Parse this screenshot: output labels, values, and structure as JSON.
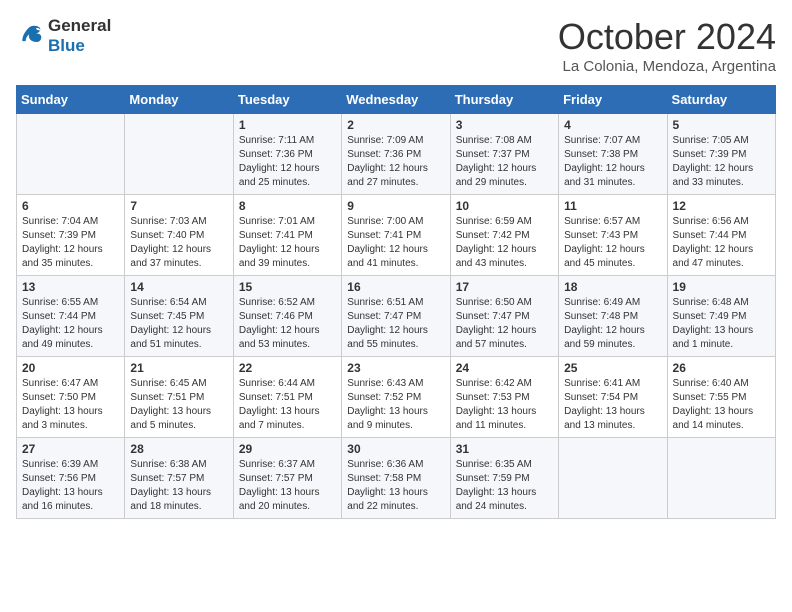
{
  "header": {
    "logo_line1": "General",
    "logo_line2": "Blue",
    "month": "October 2024",
    "location": "La Colonia, Mendoza, Argentina"
  },
  "weekdays": [
    "Sunday",
    "Monday",
    "Tuesday",
    "Wednesday",
    "Thursday",
    "Friday",
    "Saturday"
  ],
  "weeks": [
    [
      {
        "day": "",
        "info": ""
      },
      {
        "day": "",
        "info": ""
      },
      {
        "day": "1",
        "info": "Sunrise: 7:11 AM\nSunset: 7:36 PM\nDaylight: 12 hours\nand 25 minutes."
      },
      {
        "day": "2",
        "info": "Sunrise: 7:09 AM\nSunset: 7:36 PM\nDaylight: 12 hours\nand 27 minutes."
      },
      {
        "day": "3",
        "info": "Sunrise: 7:08 AM\nSunset: 7:37 PM\nDaylight: 12 hours\nand 29 minutes."
      },
      {
        "day": "4",
        "info": "Sunrise: 7:07 AM\nSunset: 7:38 PM\nDaylight: 12 hours\nand 31 minutes."
      },
      {
        "day": "5",
        "info": "Sunrise: 7:05 AM\nSunset: 7:39 PM\nDaylight: 12 hours\nand 33 minutes."
      }
    ],
    [
      {
        "day": "6",
        "info": "Sunrise: 7:04 AM\nSunset: 7:39 PM\nDaylight: 12 hours\nand 35 minutes."
      },
      {
        "day": "7",
        "info": "Sunrise: 7:03 AM\nSunset: 7:40 PM\nDaylight: 12 hours\nand 37 minutes."
      },
      {
        "day": "8",
        "info": "Sunrise: 7:01 AM\nSunset: 7:41 PM\nDaylight: 12 hours\nand 39 minutes."
      },
      {
        "day": "9",
        "info": "Sunrise: 7:00 AM\nSunset: 7:41 PM\nDaylight: 12 hours\nand 41 minutes."
      },
      {
        "day": "10",
        "info": "Sunrise: 6:59 AM\nSunset: 7:42 PM\nDaylight: 12 hours\nand 43 minutes."
      },
      {
        "day": "11",
        "info": "Sunrise: 6:57 AM\nSunset: 7:43 PM\nDaylight: 12 hours\nand 45 minutes."
      },
      {
        "day": "12",
        "info": "Sunrise: 6:56 AM\nSunset: 7:44 PM\nDaylight: 12 hours\nand 47 minutes."
      }
    ],
    [
      {
        "day": "13",
        "info": "Sunrise: 6:55 AM\nSunset: 7:44 PM\nDaylight: 12 hours\nand 49 minutes."
      },
      {
        "day": "14",
        "info": "Sunrise: 6:54 AM\nSunset: 7:45 PM\nDaylight: 12 hours\nand 51 minutes."
      },
      {
        "day": "15",
        "info": "Sunrise: 6:52 AM\nSunset: 7:46 PM\nDaylight: 12 hours\nand 53 minutes."
      },
      {
        "day": "16",
        "info": "Sunrise: 6:51 AM\nSunset: 7:47 PM\nDaylight: 12 hours\nand 55 minutes."
      },
      {
        "day": "17",
        "info": "Sunrise: 6:50 AM\nSunset: 7:47 PM\nDaylight: 12 hours\nand 57 minutes."
      },
      {
        "day": "18",
        "info": "Sunrise: 6:49 AM\nSunset: 7:48 PM\nDaylight: 12 hours\nand 59 minutes."
      },
      {
        "day": "19",
        "info": "Sunrise: 6:48 AM\nSunset: 7:49 PM\nDaylight: 13 hours\nand 1 minute."
      }
    ],
    [
      {
        "day": "20",
        "info": "Sunrise: 6:47 AM\nSunset: 7:50 PM\nDaylight: 13 hours\nand 3 minutes."
      },
      {
        "day": "21",
        "info": "Sunrise: 6:45 AM\nSunset: 7:51 PM\nDaylight: 13 hours\nand 5 minutes."
      },
      {
        "day": "22",
        "info": "Sunrise: 6:44 AM\nSunset: 7:51 PM\nDaylight: 13 hours\nand 7 minutes."
      },
      {
        "day": "23",
        "info": "Sunrise: 6:43 AM\nSunset: 7:52 PM\nDaylight: 13 hours\nand 9 minutes."
      },
      {
        "day": "24",
        "info": "Sunrise: 6:42 AM\nSunset: 7:53 PM\nDaylight: 13 hours\nand 11 minutes."
      },
      {
        "day": "25",
        "info": "Sunrise: 6:41 AM\nSunset: 7:54 PM\nDaylight: 13 hours\nand 13 minutes."
      },
      {
        "day": "26",
        "info": "Sunrise: 6:40 AM\nSunset: 7:55 PM\nDaylight: 13 hours\nand 14 minutes."
      }
    ],
    [
      {
        "day": "27",
        "info": "Sunrise: 6:39 AM\nSunset: 7:56 PM\nDaylight: 13 hours\nand 16 minutes."
      },
      {
        "day": "28",
        "info": "Sunrise: 6:38 AM\nSunset: 7:57 PM\nDaylight: 13 hours\nand 18 minutes."
      },
      {
        "day": "29",
        "info": "Sunrise: 6:37 AM\nSunset: 7:57 PM\nDaylight: 13 hours\nand 20 minutes."
      },
      {
        "day": "30",
        "info": "Sunrise: 6:36 AM\nSunset: 7:58 PM\nDaylight: 13 hours\nand 22 minutes."
      },
      {
        "day": "31",
        "info": "Sunrise: 6:35 AM\nSunset: 7:59 PM\nDaylight: 13 hours\nand 24 minutes."
      },
      {
        "day": "",
        "info": ""
      },
      {
        "day": "",
        "info": ""
      }
    ]
  ]
}
